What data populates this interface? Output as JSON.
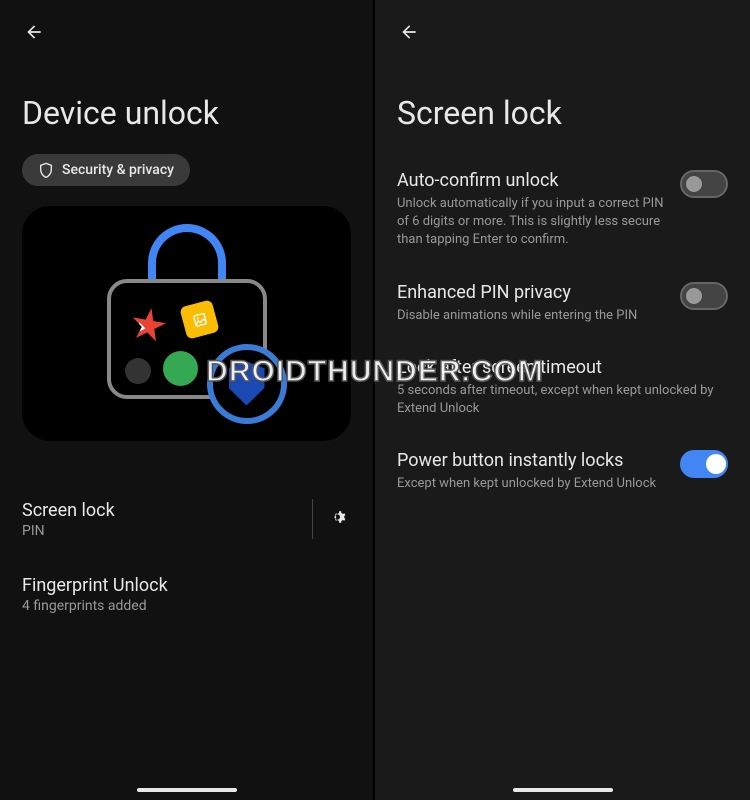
{
  "left": {
    "title": "Device unlock",
    "chip": "Security & privacy",
    "items": [
      {
        "title": "Screen lock",
        "sub": "PIN",
        "has_gear": true
      },
      {
        "title": "Fingerprint Unlock",
        "sub": "4 fingerprints added",
        "has_gear": false
      }
    ]
  },
  "right": {
    "title": "Screen lock",
    "items": [
      {
        "title": "Auto-confirm unlock",
        "desc": "Unlock automatically if you input a correct PIN of 6 digits or more. This is slightly less secure than tapping Enter to confirm.",
        "on": false
      },
      {
        "title": "Enhanced PIN privacy",
        "desc": "Disable animations while entering the PIN",
        "on": false
      },
      {
        "title": "Lock after screen timeout",
        "desc": "5 seconds after timeout, except when kept unlocked by Extend Unlock",
        "on": null
      },
      {
        "title": "Power button instantly locks",
        "desc": "Except when kept unlocked by Extend Unlock",
        "on": true
      }
    ]
  },
  "watermark": "DROIDTHUNDER.COM"
}
